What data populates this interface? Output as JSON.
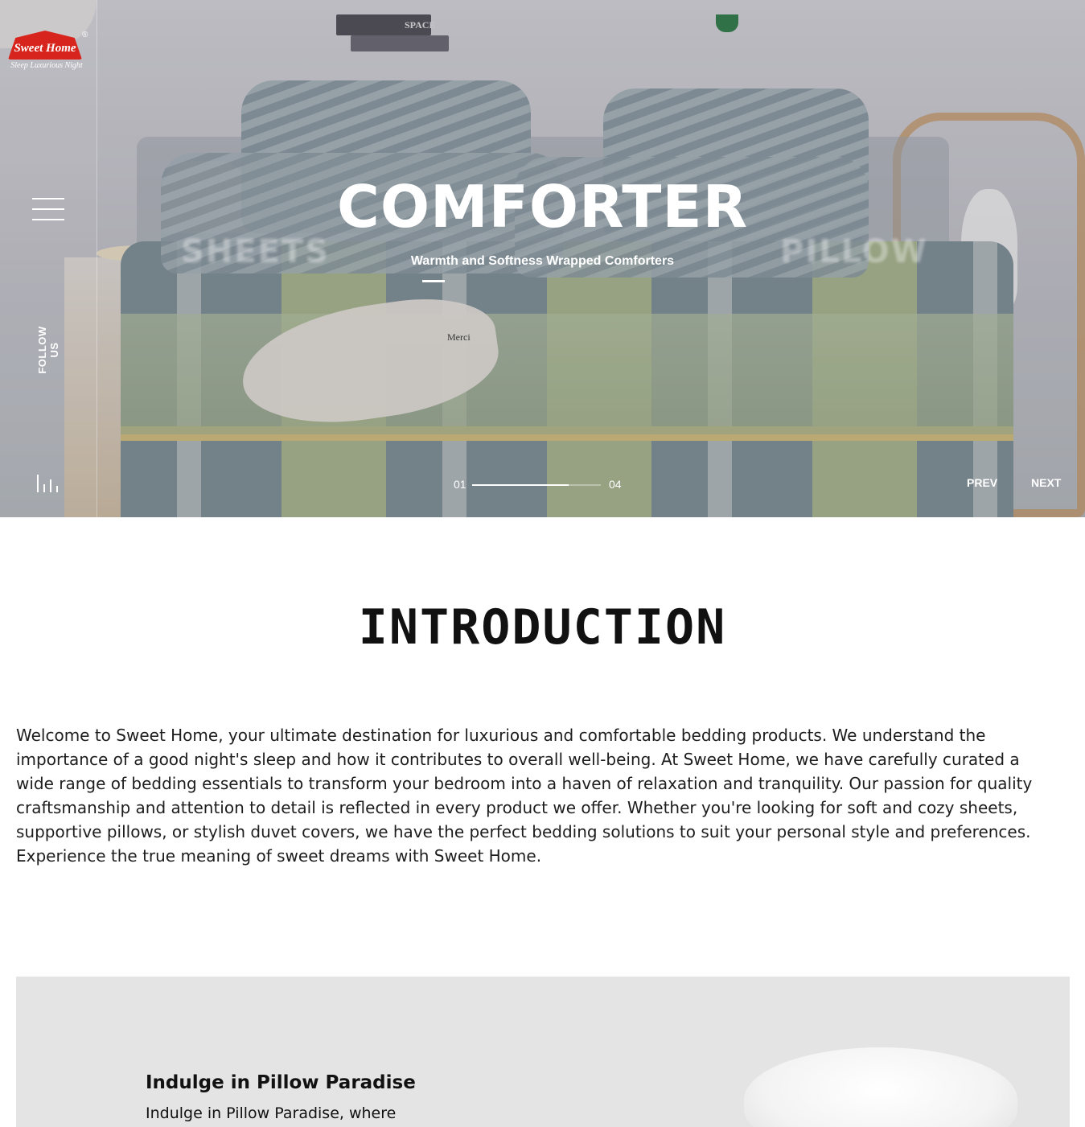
{
  "brand": {
    "name": "Sweet Home",
    "tagline": "Sleep Luxurious Night",
    "reg": "®"
  },
  "sidebar": {
    "follow_label": "FOLLOW US"
  },
  "hero": {
    "title": "COMFORTER",
    "subtitle": "Warmth and Softness Wrapped Comforters",
    "prev_word": "SHEETS",
    "next_word": "PILLOW",
    "decor": {
      "book_label": "SPACE",
      "throw_tag": "Merci"
    },
    "slide_current": "01",
    "slide_total": "04",
    "slide_progress": 0.75,
    "prev_label": "PREV",
    "next_label": "NEXT"
  },
  "intro": {
    "title": "INTRODUCTION",
    "text": "Welcome to Sweet Home, your ultimate destination for luxurious and comfortable bedding products. We understand the importance of a good night's sleep and how it contributes to overall well-being. At Sweet Home, we have carefully curated a wide range of bedding essentials to transform your bedroom into a haven of relaxation and tranquility. Our passion for quality craftsmanship and attention to detail is reflected in every product we offer. Whether you're looking for soft and cozy sheets, supportive pillows, or stylish duvet covers, we have the perfect bedding solutions to suit your personal style and preferences. Experience the true meaning of sweet dreams with Sweet Home."
  },
  "feature": {
    "title": "Indulge in Pillow Paradise",
    "text": "Indulge in Pillow Paradise, where"
  },
  "colors": {
    "brand_red": "#d7241d",
    "text_dark": "#111111",
    "feature_bg": "#e4e4e4"
  }
}
